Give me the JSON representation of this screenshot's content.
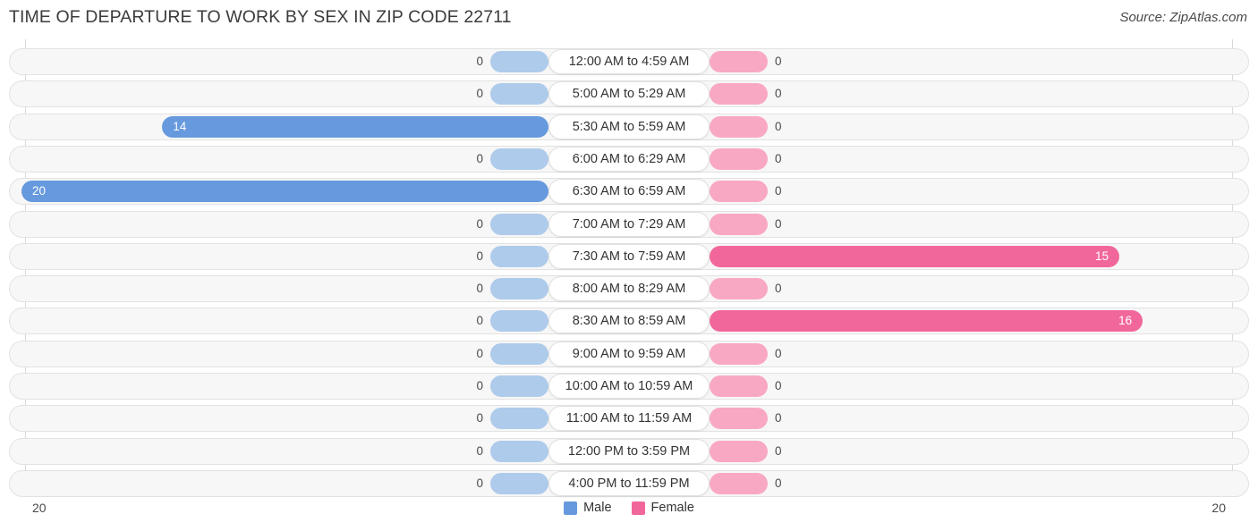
{
  "header": {
    "title": "TIME OF DEPARTURE TO WORK BY SEX IN ZIP CODE 22711",
    "source": "Source: ZipAtlas.com"
  },
  "axis": {
    "left_tick": "20",
    "right_tick": "20"
  },
  "legend": {
    "items": [
      {
        "label": "Male",
        "color": "#6699dd"
      },
      {
        "label": "Female",
        "color": "#f2679b"
      }
    ]
  },
  "colors": {
    "male_zero": "#aecbeb",
    "male_value": "#6699dd",
    "female_zero": "#f9a8c4",
    "female_value": "#f2679b",
    "track": "#f7f7f7",
    "track_border": "#e2e2e2",
    "gridline": "#d9d9d9"
  },
  "chart_data": {
    "type": "bar",
    "orientation": "horizontal-diverging",
    "title": "TIME OF DEPARTURE TO WORK BY SEX IN ZIP CODE 22711",
    "xlabel": "",
    "ylabel": "",
    "xlim": [
      20,
      20
    ],
    "axis_max": 20,
    "grid": true,
    "legend_position": "bottom-center",
    "categories": [
      "12:00 AM to 4:59 AM",
      "5:00 AM to 5:29 AM",
      "5:30 AM to 5:59 AM",
      "6:00 AM to 6:29 AM",
      "6:30 AM to 6:59 AM",
      "7:00 AM to 7:29 AM",
      "7:30 AM to 7:59 AM",
      "8:00 AM to 8:29 AM",
      "8:30 AM to 8:59 AM",
      "9:00 AM to 9:59 AM",
      "10:00 AM to 10:59 AM",
      "11:00 AM to 11:59 AM",
      "12:00 PM to 3:59 PM",
      "4:00 PM to 11:59 PM"
    ],
    "series": [
      {
        "name": "Male",
        "color": "#6699dd",
        "values": [
          0,
          0,
          14,
          0,
          20,
          0,
          0,
          0,
          0,
          0,
          0,
          0,
          0,
          0
        ]
      },
      {
        "name": "Female",
        "color": "#f2679b",
        "values": [
          0,
          0,
          0,
          0,
          0,
          0,
          15,
          0,
          16,
          0,
          0,
          0,
          0,
          0
        ]
      }
    ]
  }
}
